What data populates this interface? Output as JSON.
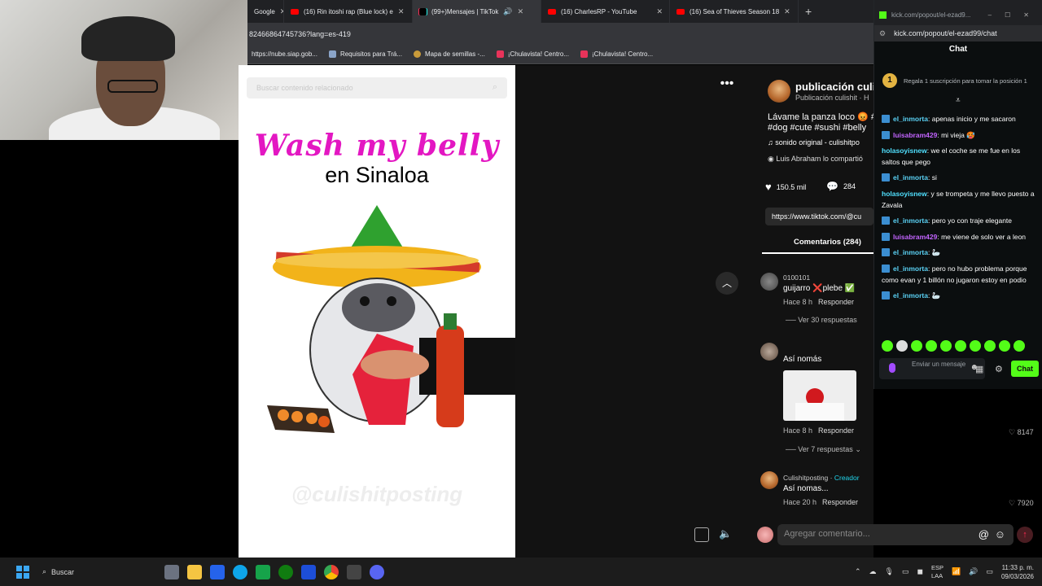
{
  "tabs": [
    {
      "label": "Google",
      "icon": "google-icon"
    },
    {
      "label": "(16) Rin itoshi rap (Blue lock) e",
      "icon": "youtube-icon"
    },
    {
      "label": "(99+)Mensajes | TikTok",
      "icon": "tiktok-icon"
    },
    {
      "label": "(16) CharlesRP - YouTube",
      "icon": "youtube-icon"
    },
    {
      "label": "(16) Sea of Thieves Season 18",
      "icon": "youtube-icon"
    }
  ],
  "address": {
    "url": "82466864745736?lang=es-419"
  },
  "bookmarks": [
    {
      "label": "https://nube.siap.gob...",
      "color": "#3a7bd5"
    },
    {
      "label": "Requisitos para Trá...",
      "color": "#8aa4c8"
    },
    {
      "label": "Mapa de semillas -...",
      "color": "#c99b3a"
    },
    {
      "label": "¡Chulavista! Centro...",
      "color": "#e8335a"
    },
    {
      "label": "¡Chulavista! Centro...",
      "color": "#e8335a"
    }
  ],
  "video": {
    "search_placeholder": "Buscar contenido relacionado",
    "title_line1": "Wash my belly",
    "title_line2": "en Sinaloa",
    "watermark": "@culishitposting"
  },
  "post": {
    "author": "publicación culis",
    "subtitle": "Publicación culishit · H",
    "caption_line1": "Lávame la panza loco 😡 #",
    "caption_line2": "#dog #cute #sushi #belly",
    "sound": "sonido original - culishitpo",
    "shared": "Luis Abraham lo compartió",
    "likes": "150.5 mil",
    "comments_count": "284",
    "link": "https://www.tiktok.com/@cu",
    "comments_tab": "Comentarios (284)"
  },
  "comments": [
    {
      "user": "0100101",
      "text": "guijarro ❌plebe ✅",
      "time": "Hace 8 h",
      "reply": "Responder",
      "more": "Ver 30 respuestas"
    },
    {
      "user": "",
      "text": "Así nomás",
      "time": "Hace 8 h",
      "reply": "Responder",
      "likes": "8147",
      "more": "Ver 7 respuestas"
    },
    {
      "user": "Culishitposting",
      "creator": "Creador",
      "text": "Así nomas...",
      "time": "Hace 20 h",
      "reply": "Responder",
      "likes": "7920"
    }
  ],
  "comment_input": {
    "placeholder": "Agregar comentario..."
  },
  "kick": {
    "window_title": "kick.com/popout/el-ezad9...",
    "url": "kick.com/popout/el-ezad99/chat",
    "chat_title": "Chat",
    "sub_text": "Regala 1 suscripción para tomar la posición 1",
    "sub_rank": "1",
    "messages": [
      {
        "user": "el_inmorta",
        "text": "apenas inicio y me sacaron",
        "cls": "u1"
      },
      {
        "user": "luisabram429",
        "text": "mi vieja 🥵",
        "cls": "u2"
      },
      {
        "user": "holasoyisnew",
        "text": "we el coche se me fue en los saltos que pego",
        "cls": "u3"
      },
      {
        "user": "el_inmorta",
        "text": "si",
        "cls": "u1"
      },
      {
        "user": "holasoyisnew",
        "text": "y se trompeta y me llevo puesto a Zavala",
        "cls": "u3"
      },
      {
        "user": "el_inmorta",
        "text": "pero yo con traje elegante",
        "cls": "u1"
      },
      {
        "user": "luisabram429",
        "text": "me viene de solo ver a leon",
        "cls": "u2"
      },
      {
        "user": "el_inmorta",
        "text": "🦢",
        "cls": "u1"
      },
      {
        "user": "el_inmorta",
        "text": "pero no hubo problema porque como evan y 1 billón no jugaron estoy en podio",
        "cls": "u1"
      },
      {
        "user": "el_inmorta",
        "text": "🦢",
        "cls": "u1"
      }
    ],
    "input_placeholder": "Enviar un mensaje",
    "send_label": "Chat"
  },
  "taskbar": {
    "search_label": "Buscar",
    "lang_line1": "ESP",
    "lang_line2": "LAA",
    "time": "11:33 p. m.",
    "date": "09/03/2026"
  }
}
